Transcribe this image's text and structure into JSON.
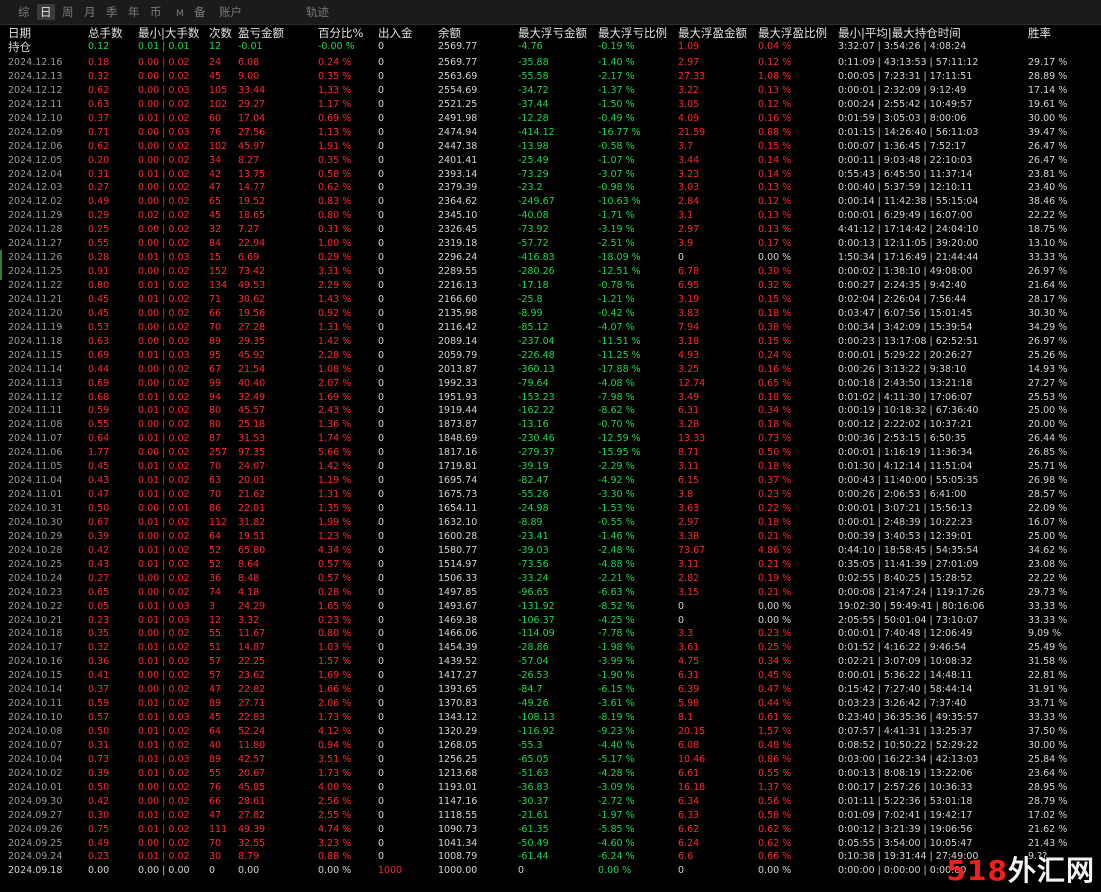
{
  "toolbar": {
    "tabs": [
      {
        "label": "综",
        "active": false
      },
      {
        "label": "日",
        "active": true
      },
      {
        "label": "周",
        "active": false
      },
      {
        "label": "月",
        "active": false
      },
      {
        "label": "季",
        "active": false
      },
      {
        "label": "年",
        "active": false
      },
      {
        "label": "币",
        "active": false
      },
      {
        "label": "M",
        "active": false
      },
      {
        "label": "备",
        "active": false
      },
      {
        "label": "账户",
        "active": false
      },
      {
        "label": "轨迹",
        "active": false
      }
    ]
  },
  "header": {
    "date": "日期",
    "total_lots": "总手数",
    "min_max_lots": "最小|大手数",
    "count": "次数",
    "pnl": "盈亏金额",
    "pct": "百分比%",
    "io": "出入金",
    "balance": "余额",
    "max_float_loss": "最大浮亏金额",
    "max_float_loss_pct": "最大浮亏比例",
    "max_float_profit": "最大浮盈金额",
    "max_float_profit_pct": "最大浮盈比例",
    "hold_time": "最小|平均|最大持仓时间",
    "winrate": "胜率"
  },
  "summary": {
    "label": "持仓",
    "total_lots": "0.12",
    "min_max_lots": "0.01 | 0.01",
    "count": "12",
    "pnl": "-0.01",
    "pct": "-0.00 %",
    "io": "0",
    "balance": "2569.77",
    "max_float_loss": "-4.76",
    "max_float_loss_pct": "-0.19 %",
    "max_float_profit": "1.09",
    "max_float_profit_pct": "0.04 %",
    "hold_time": "3:32:07 | 3:54:26 | 4:08:24",
    "winrate": ""
  },
  "rows": [
    [
      "2024.12.16",
      "0.18",
      "0.00 | 0.02",
      "24",
      "6.08",
      "0.24 %",
      "0",
      "2569.77",
      "-35.88",
      "-1.40 %",
      "2.97",
      "0.12 %",
      "0:11:09 | 43:13:53 | 57:11:12",
      "29.17 %"
    ],
    [
      "2024.12.13",
      "0.32",
      "0.00 | 0.02",
      "45",
      "9.00",
      "0.35 %",
      "0",
      "2563.69",
      "-55.58",
      "-2.17 %",
      "27.33",
      "1.08 %",
      "0:00:05 | 7:23:31 | 17:11:51",
      "28.89 %"
    ],
    [
      "2024.12.12",
      "0.62",
      "0.00 | 0.03",
      "105",
      "33.44",
      "1.33 %",
      "0",
      "2554.69",
      "-34.72",
      "-1.37 %",
      "3.22",
      "0.13 %",
      "0:00:01 | 2:32:09 | 9:12:49",
      "17.14 %"
    ],
    [
      "2024.12.11",
      "0.63",
      "0.00 | 0.02",
      "102",
      "29.27",
      "1.17 %",
      "0",
      "2521.25",
      "-37.44",
      "-1.50 %",
      "3.05",
      "0.12 %",
      "0:00:24 | 2:55:42 | 10:49:57",
      "19.61 %"
    ],
    [
      "2024.12.10",
      "0.37",
      "0.01 | 0.02",
      "60",
      "17.04",
      "0.69 %",
      "0",
      "2491.98",
      "-12.28",
      "-0.49 %",
      "4.09",
      "0.16 %",
      "0:01:59 | 3:05:03 | 8:00:06",
      "30.00 %"
    ],
    [
      "2024.12.09",
      "0.71",
      "0.00 | 0.03",
      "76",
      "27.56",
      "1.13 %",
      "0",
      "2474.94",
      "-414.12",
      "-16.77 %",
      "21.59",
      "0.88 %",
      "0:01:15 | 14:26:40 | 56:11:03",
      "39.47 %"
    ],
    [
      "2024.12.06",
      "0.62",
      "0.00 | 0.02",
      "102",
      "45.97",
      "1.91 %",
      "0",
      "2447.38",
      "-13.98",
      "-0.58 %",
      "3.7",
      "0.15 %",
      "0:00:07 | 1:36:45 | 7:52:17",
      "26.47 %"
    ],
    [
      "2024.12.05",
      "0.20",
      "0.00 | 0.02",
      "34",
      "8.27",
      "0.35 %",
      "0",
      "2401.41",
      "-25.49",
      "-1.07 %",
      "3.44",
      "0.14 %",
      "0:00:11 | 9:03:48 | 22:10:03",
      "26.47 %"
    ],
    [
      "2024.12.04",
      "0.31",
      "0.01 | 0.02",
      "42",
      "13.75",
      "0.58 %",
      "0",
      "2393.14",
      "-73.29",
      "-3.07 %",
      "3.23",
      "0.14 %",
      "0:55:43 | 6:45:50 | 11:37:14",
      "23.81 %"
    ],
    [
      "2024.12.03",
      "0.27",
      "0.00 | 0.02",
      "47",
      "14.77",
      "0.62 %",
      "0",
      "2379.39",
      "-23.2",
      "-0.98 %",
      "3.03",
      "0.13 %",
      "0:00:40 | 5:37:59 | 12:10:11",
      "23.40 %"
    ],
    [
      "2024.12.02",
      "0.49",
      "0.00 | 0.02",
      "65",
      "19.52",
      "0.83 %",
      "0",
      "2364.62",
      "-249.67",
      "-10.63 %",
      "2.84",
      "0.12 %",
      "0:00:14 | 11:42:38 | 55:15:04",
      "38.46 %"
    ],
    [
      "2024.11.29",
      "0.29",
      "0.02 | 0.02",
      "45",
      "18.65",
      "0.80 %",
      "0",
      "2345.10",
      "-40.08",
      "-1.71 %",
      "3.1",
      "0.13 %",
      "0:00:01 | 6:29:49 | 16:07:00",
      "22.22 %"
    ],
    [
      "2024.11.28",
      "0.25",
      "0.00 | 0.02",
      "32",
      "7.27",
      "0.31 %",
      "0",
      "2326.45",
      "-73.92",
      "-3.19 %",
      "2.97",
      "0.13 %",
      "4:41:12 | 17:14:42 | 24:04:10",
      "18.75 %"
    ],
    [
      "2024.11.27",
      "0.55",
      "0.00 | 0.02",
      "84",
      "22.94",
      "1.00 %",
      "0",
      "2319.18",
      "-57.72",
      "-2.51 %",
      "3.9",
      "0.17 %",
      "0:00:13 | 12:11:05 | 39:20:00",
      "13.10 %"
    ],
    [
      "2024.11.26",
      "0.28",
      "0.01 | 0.03",
      "15",
      "6.69",
      "0.29 %",
      "0",
      "2296.24",
      "-416.83",
      "-18.09 %",
      "0",
      "0.00 %",
      "1:50:34 | 17:16:49 | 21:44:44",
      "33.33 %"
    ],
    [
      "2024.11.25",
      "0.91",
      "0.00 | 0.02",
      "152",
      "73.42",
      "3.31 %",
      "0",
      "2289.55",
      "-280.26",
      "-12.51 %",
      "6.78",
      "0.30 %",
      "0:00:02 | 1:38:10 | 49:08:00",
      "26.97 %"
    ],
    [
      "2024.11.22",
      "0.80",
      "0.01 | 0.02",
      "134",
      "49.53",
      "2.29 %",
      "0",
      "2216.13",
      "-17.18",
      "-0.78 %",
      "6.95",
      "0.32 %",
      "0:00:27 | 2:24:35 | 9:42:40",
      "21.64 %"
    ],
    [
      "2024.11.21",
      "0.45",
      "0.01 | 0.02",
      "71",
      "30.62",
      "1.43 %",
      "0",
      "2166.60",
      "-25.8",
      "-1.21 %",
      "3.19",
      "0.15 %",
      "0:02:04 | 2:26:04 | 7:56:44",
      "28.17 %"
    ],
    [
      "2024.11.20",
      "0.45",
      "0.00 | 0.02",
      "66",
      "19.56",
      "0.92 %",
      "0",
      "2135.98",
      "-8.99",
      "-0.42 %",
      "3.83",
      "0.18 %",
      "0:03:47 | 6:07:56 | 15:01:45",
      "30.30 %"
    ],
    [
      "2024.11.19",
      "0.53",
      "0.00 | 0.02",
      "70",
      "27.28",
      "1.31 %",
      "0",
      "2116.42",
      "-85.12",
      "-4.07 %",
      "7.94",
      "0.38 %",
      "0:00:34 | 3:42:09 | 15:39:54",
      "34.29 %"
    ],
    [
      "2024.11.18",
      "0.63",
      "0.00 | 0.02",
      "89",
      "29.35",
      "1.42 %",
      "0",
      "2089.14",
      "-237.04",
      "-11.51 %",
      "3.18",
      "0.15 %",
      "0:00:23 | 13:17:08 | 62:52:51",
      "26.97 %"
    ],
    [
      "2024.11.15",
      "0.69",
      "0.01 | 0.03",
      "95",
      "45.92",
      "2.28 %",
      "0",
      "2059.79",
      "-226.48",
      "-11.25 %",
      "4.93",
      "0.24 %",
      "0:00:01 | 5:29:22 | 20:26:27",
      "25.26 %"
    ],
    [
      "2024.11.14",
      "0.44",
      "0.00 | 0.02",
      "67",
      "21.54",
      "1.08 %",
      "0",
      "2013.87",
      "-360.13",
      "-17.88 %",
      "3.25",
      "0.16 %",
      "0:00:26 | 3:13:22 | 9:38:10",
      "14.93 %"
    ],
    [
      "2024.11.13",
      "0.69",
      "0.00 | 0.02",
      "99",
      "40.40",
      "2.07 %",
      "0",
      "1992.33",
      "-79.64",
      "-4.08 %",
      "12.74",
      "0.65 %",
      "0:00:18 | 2:43:50 | 13:21:18",
      "27.27 %"
    ],
    [
      "2024.11.12",
      "0.68",
      "0.01 | 0.02",
      "94",
      "32.49",
      "1.69 %",
      "0",
      "1951.93",
      "-153.23",
      "-7.98 %",
      "3.49",
      "0.18 %",
      "0:01:02 | 4:11:30 | 17:06:07",
      "25.53 %"
    ],
    [
      "2024.11.11",
      "0.59",
      "0.01 | 0.02",
      "80",
      "45.57",
      "2.43 %",
      "0",
      "1919.44",
      "-162.22",
      "-8.62 %",
      "6.31",
      "0.34 %",
      "0:00:19 | 10:18:32 | 67:36:40",
      "25.00 %"
    ],
    [
      "2024.11.08",
      "0.55",
      "0.00 | 0.02",
      "80",
      "25.18",
      "1.36 %",
      "0",
      "1873.87",
      "-13.16",
      "-0.70 %",
      "3.28",
      "0.18 %",
      "0:00:12 | 2:22:02 | 10:37:21",
      "20.00 %"
    ],
    [
      "2024.11.07",
      "0.64",
      "0.01 | 0.02",
      "87",
      "31.53",
      "1.74 %",
      "0",
      "1848.69",
      "-230.46",
      "-12.59 %",
      "13.33",
      "0.73 %",
      "0:00:36 | 2:53:15 | 6:50:35",
      "26.44 %"
    ],
    [
      "2024.11.06",
      "1.77",
      "0.00 | 0.02",
      "257",
      "97.35",
      "5.66 %",
      "0",
      "1817.16",
      "-279.37",
      "-15.95 %",
      "8.71",
      "0.50 %",
      "0:00:01 | 1:16:19 | 11:36:34",
      "26.85 %"
    ],
    [
      "2024.11.05",
      "0.45",
      "0.01 | 0.02",
      "70",
      "24.07",
      "1.42 %",
      "0",
      "1719.81",
      "-39.19",
      "-2.29 %",
      "3.11",
      "0.18 %",
      "0:01:30 | 4:12:14 | 11:51:04",
      "25.71 %"
    ],
    [
      "2024.11.04",
      "0.43",
      "0.01 | 0.02",
      "63",
      "20.01",
      "1.19 %",
      "0",
      "1695.74",
      "-82.47",
      "-4.92 %",
      "6.15",
      "0.37 %",
      "0:00:43 | 11:40:00 | 55:05:35",
      "26.98 %"
    ],
    [
      "2024.11.01",
      "0.47",
      "0.01 | 0.02",
      "70",
      "21.62",
      "1.31 %",
      "0",
      "1675.73",
      "-55.26",
      "-3.30 %",
      "3.8",
      "0.23 %",
      "0:00:26 | 2:06:53 | 6:41:00",
      "28.57 %"
    ],
    [
      "2024.10.31",
      "0.50",
      "0.00 | 0.01",
      "86",
      "22.01",
      "1.35 %",
      "0",
      "1654.11",
      "-24.98",
      "-1.53 %",
      "3.63",
      "0.22 %",
      "0:00:01 | 3:07:21 | 15:56:13",
      "22.09 %"
    ],
    [
      "2024.10.30",
      "0.67",
      "0.01 | 0.02",
      "112",
      "31.82",
      "1.99 %",
      "0",
      "1632.10",
      "-8.89",
      "-0.55 %",
      "2.97",
      "0.18 %",
      "0:00:01 | 2:48:39 | 10:22:23",
      "16.07 %"
    ],
    [
      "2024.10.29",
      "0.39",
      "0.00 | 0.02",
      "64",
      "19.51",
      "1.23 %",
      "0",
      "1600.28",
      "-23.41",
      "-1.46 %",
      "3.38",
      "0.21 %",
      "0:00:39 | 3:40:53 | 12:39:01",
      "25.00 %"
    ],
    [
      "2024.10.28",
      "0.42",
      "0.01 | 0.02",
      "52",
      "65.80",
      "4.34 %",
      "0",
      "1580.77",
      "-39.03",
      "-2.48 %",
      "73.67",
      "4.86 %",
      "0:44:10 | 18:58:45 | 54:35:54",
      "34.62 %"
    ],
    [
      "2024.10.25",
      "0.43",
      "0.01 | 0.02",
      "52",
      "8.64",
      "0.57 %",
      "0",
      "1514.97",
      "-73.56",
      "-4.88 %",
      "3.11",
      "0.21 %",
      "0:35:05 | 11:41:39 | 27:01:09",
      "23.08 %"
    ],
    [
      "2024.10.24",
      "0.27",
      "0.00 | 0.02",
      "36",
      "8.48",
      "0.57 %",
      "0",
      "1506.33",
      "-33.24",
      "-2.21 %",
      "2.82",
      "0.19 %",
      "0:02:55 | 8:40:25 | 15:28:52",
      "22.22 %"
    ],
    [
      "2024.10.23",
      "0.65",
      "0.00 | 0.02",
      "74",
      "4.18",
      "0.28 %",
      "0",
      "1497.85",
      "-96.65",
      "-6.63 %",
      "3.15",
      "0.21 %",
      "0:00:08 | 21:47:24 | 119:17:26",
      "29.73 %"
    ],
    [
      "2024.10.22",
      "0.05",
      "0.01 | 0.03",
      "3",
      "24.29",
      "1.65 %",
      "0",
      "1493.67",
      "-131.92",
      "-8.52 %",
      "0",
      "0.00 %",
      "19:02:30 | 59:49:41 | 80:16:06",
      "33.33 %"
    ],
    [
      "2024.10.21",
      "0.23",
      "0.01 | 0.03",
      "12",
      "3.32",
      "0.23 %",
      "0",
      "1469.38",
      "-106.37",
      "-4.25 %",
      "0",
      "0.00 %",
      "2:05:55 | 50:01:04 | 73:10:07",
      "33.33 %"
    ],
    [
      "2024.10.18",
      "0.35",
      "0.00 | 0.02",
      "55",
      "11.67",
      "0.80 %",
      "0",
      "1466.06",
      "-114.09",
      "-7.78 %",
      "3.3",
      "0.23 %",
      "0:00:01 | 7:40:48 | 12:06:49",
      "9.09 %"
    ],
    [
      "2024.10.17",
      "0.32",
      "0.01 | 0.02",
      "51",
      "14.87",
      "1.03 %",
      "0",
      "1454.39",
      "-28.86",
      "-1.98 %",
      "3.61",
      "0.25 %",
      "0:01:52 | 4:16:22 | 9:46:54",
      "25.49 %"
    ],
    [
      "2024.10.16",
      "0.36",
      "0.01 | 0.02",
      "57",
      "22.25",
      "1.57 %",
      "0",
      "1439.52",
      "-57.04",
      "-3.99 %",
      "4.75",
      "0.34 %",
      "0:02:21 | 3:07:09 | 10:08:32",
      "31.58 %"
    ],
    [
      "2024.10.15",
      "0.41",
      "0.00 | 0.02",
      "57",
      "23.62",
      "1.69 %",
      "0",
      "1417.27",
      "-26.53",
      "-1.90 %",
      "6.31",
      "0.45 %",
      "0:00:01 | 5:36:22 | 14:48:11",
      "22.81 %"
    ],
    [
      "2024.10.14",
      "0.37",
      "0.00 | 0.02",
      "47",
      "22.82",
      "1.66 %",
      "0",
      "1393.65",
      "-84.7",
      "-6.15 %",
      "6.39",
      "0.47 %",
      "0:15:42 | 7:27:40 | 58:44:14",
      "31.91 %"
    ],
    [
      "2024.10.11",
      "0.59",
      "0.01 | 0.02",
      "89",
      "27.71",
      "2.06 %",
      "0",
      "1370.83",
      "-49.26",
      "-3.61 %",
      "5.98",
      "0.44 %",
      "0:03:23 | 3:26:42 | 7:37:40",
      "33.71 %"
    ],
    [
      "2024.10.10",
      "0.57",
      "0.01 | 0.03",
      "45",
      "22.83",
      "1.73 %",
      "0",
      "1343.12",
      "-108.13",
      "-8.19 %",
      "8.1",
      "0.61 %",
      "0:23:40 | 36:35:36 | 49:35:57",
      "33.33 %"
    ],
    [
      "2024.10.08",
      "0.50",
      "0.01 | 0.02",
      "64",
      "52.24",
      "4.12 %",
      "0",
      "1320.29",
      "-116.92",
      "-9.23 %",
      "20.15",
      "1.57 %",
      "0:07:57 | 4:41:31 | 13:25:37",
      "37.50 %"
    ],
    [
      "2024.10.07",
      "0.31",
      "0.01 | 0.02",
      "40",
      "11.80",
      "0.94 %",
      "0",
      "1268.05",
      "-55.3",
      "-4.40 %",
      "6.08",
      "0.48 %",
      "0:08:52 | 10:50:22 | 52:29:22",
      "30.00 %"
    ],
    [
      "2024.10.04",
      "0.73",
      "0.01 | 0.03",
      "89",
      "42.57",
      "3.51 %",
      "0",
      "1256.25",
      "-65.05",
      "-5.17 %",
      "10.46",
      "0.86 %",
      "0:03:00 | 16:22:34 | 42:13:03",
      "25.84 %"
    ],
    [
      "2024.10.02",
      "0.39",
      "0.01 | 0.02",
      "55",
      "20.67",
      "1.73 %",
      "0",
      "1213.68",
      "-51.63",
      "-4.28 %",
      "6.61",
      "0.55 %",
      "0:00:13 | 8:08:19 | 13:22:06",
      "23.64 %"
    ],
    [
      "2024.10.01",
      "0.50",
      "0.00 | 0.02",
      "76",
      "45.85",
      "4.00 %",
      "0",
      "1193.01",
      "-36.83",
      "-3.09 %",
      "16.18",
      "1.37 %",
      "0:00:17 | 2:57:26 | 10:36:33",
      "28.95 %"
    ],
    [
      "2024.09.30",
      "0.42",
      "0.00 | 0.02",
      "66",
      "28.61",
      "2.56 %",
      "0",
      "1147.16",
      "-30.37",
      "-2.72 %",
      "6.34",
      "0.56 %",
      "0:01:11 | 5:22:36 | 53:01:18",
      "28.79 %"
    ],
    [
      "2024.09.27",
      "0.30",
      "0.01 | 0.02",
      "47",
      "27.82",
      "2.55 %",
      "0",
      "1118.55",
      "-21.61",
      "-1.97 %",
      "6.33",
      "0.58 %",
      "0:01:09 | 7:02:41 | 19:42:17",
      "17.02 %"
    ],
    [
      "2024.09.26",
      "0.75",
      "0.01 | 0.02",
      "111",
      "49.39",
      "4.74 %",
      "0",
      "1090.73",
      "-61.35",
      "-5.85 %",
      "6.62",
      "0.62 %",
      "0:00:12 | 3:21:39 | 19:06:56",
      "21.62 %"
    ],
    [
      "2024.09.25",
      "0.49",
      "0.00 | 0.02",
      "70",
      "32.55",
      "3.23 %",
      "0",
      "1041.34",
      "-50.49",
      "-4.60 %",
      "6.24",
      "0.62 %",
      "0:05:55 | 3:54:00 | 10:05:47",
      "21.43 %"
    ],
    [
      "2024.09.24",
      "0.23",
      "0.01 | 0.02",
      "30",
      "8.79",
      "0.88 %",
      "0",
      "1008.79",
      "-61.44",
      "-6.24 %",
      "6.6",
      "0.66 %",
      "0:10:38 | 19:31:44 | 27:49:00",
      "9.??"
    ],
    [
      "2024.09.18",
      "0.00",
      "0.00 | 0.00",
      "0",
      "0.00",
      "0.00 %",
      "1000",
      "1000.00",
      "0",
      "0.00 %",
      "0",
      "0.00 %",
      "0:00:00 | 0:00:00 | 0:00:00",
      ""
    ]
  ],
  "watermark": {
    "num": "518",
    "text": "外汇网"
  },
  "colors": {
    "profit": "#ff2a2a",
    "loss": "#22d64a",
    "neutral": "#d4d4d4"
  }
}
